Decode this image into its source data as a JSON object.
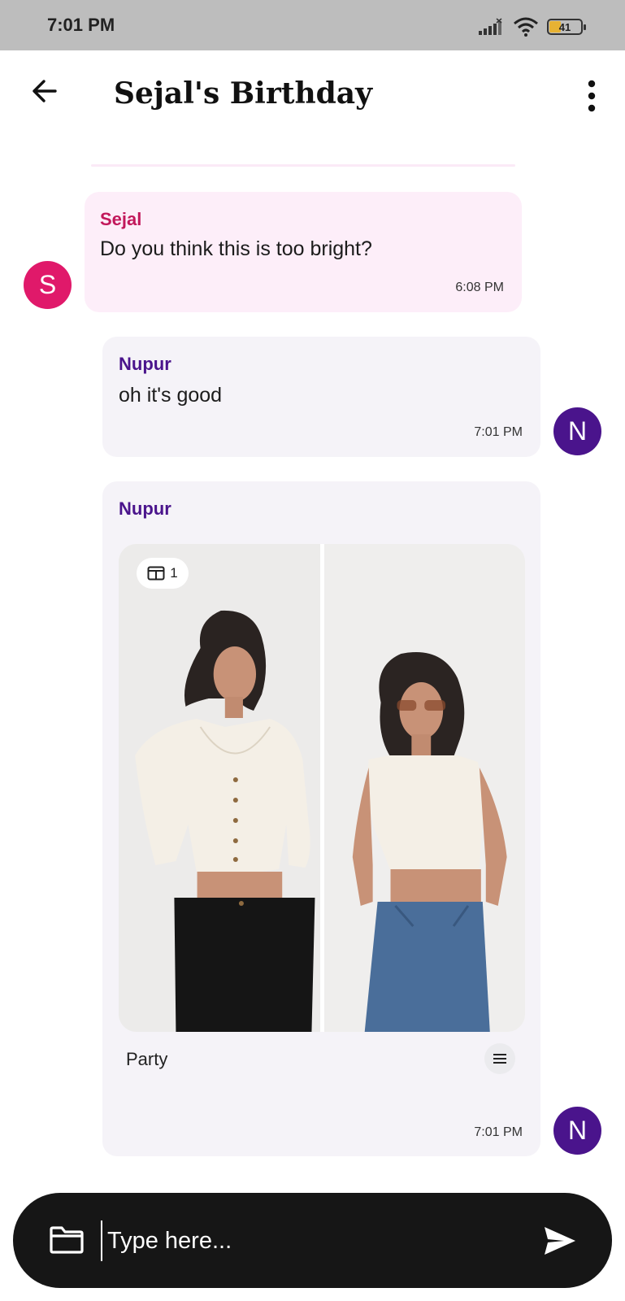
{
  "status_bar": {
    "time": "7:01 PM",
    "battery": "41",
    "battery_level": 0.41,
    "icons": [
      "signal-icon",
      "wifi-icon",
      "battery-icon"
    ]
  },
  "header": {
    "title": "Sejal's Birthday",
    "icons": [
      "back-arrow-icon",
      "more-vert-icon"
    ]
  },
  "messages": [
    {
      "sender": "Sejal",
      "text": "Do you think this is too bright?",
      "time": "6:08 PM",
      "avatar": "S"
    },
    {
      "sender": "Nupur",
      "text": "oh it's good",
      "time": "7:01 PM",
      "avatar": "N"
    },
    {
      "sender": "Nupur",
      "image_badge": "1",
      "label": "Party",
      "time": "7:01 PM",
      "avatar": "N"
    }
  ],
  "composer": {
    "placeholder": "Type here...",
    "icons": [
      "folder-icon",
      "send-icon"
    ]
  },
  "colors": {
    "incoming_bubble": "#fdeef9",
    "outgoing_bubble": "#f5f3f8",
    "sejal_avatar": "#e0196a",
    "sejal_name": "#c2185b",
    "nupur_avatar": "#4a148c",
    "nupur_name": "#4a148c",
    "composer_bg": "#161616"
  }
}
